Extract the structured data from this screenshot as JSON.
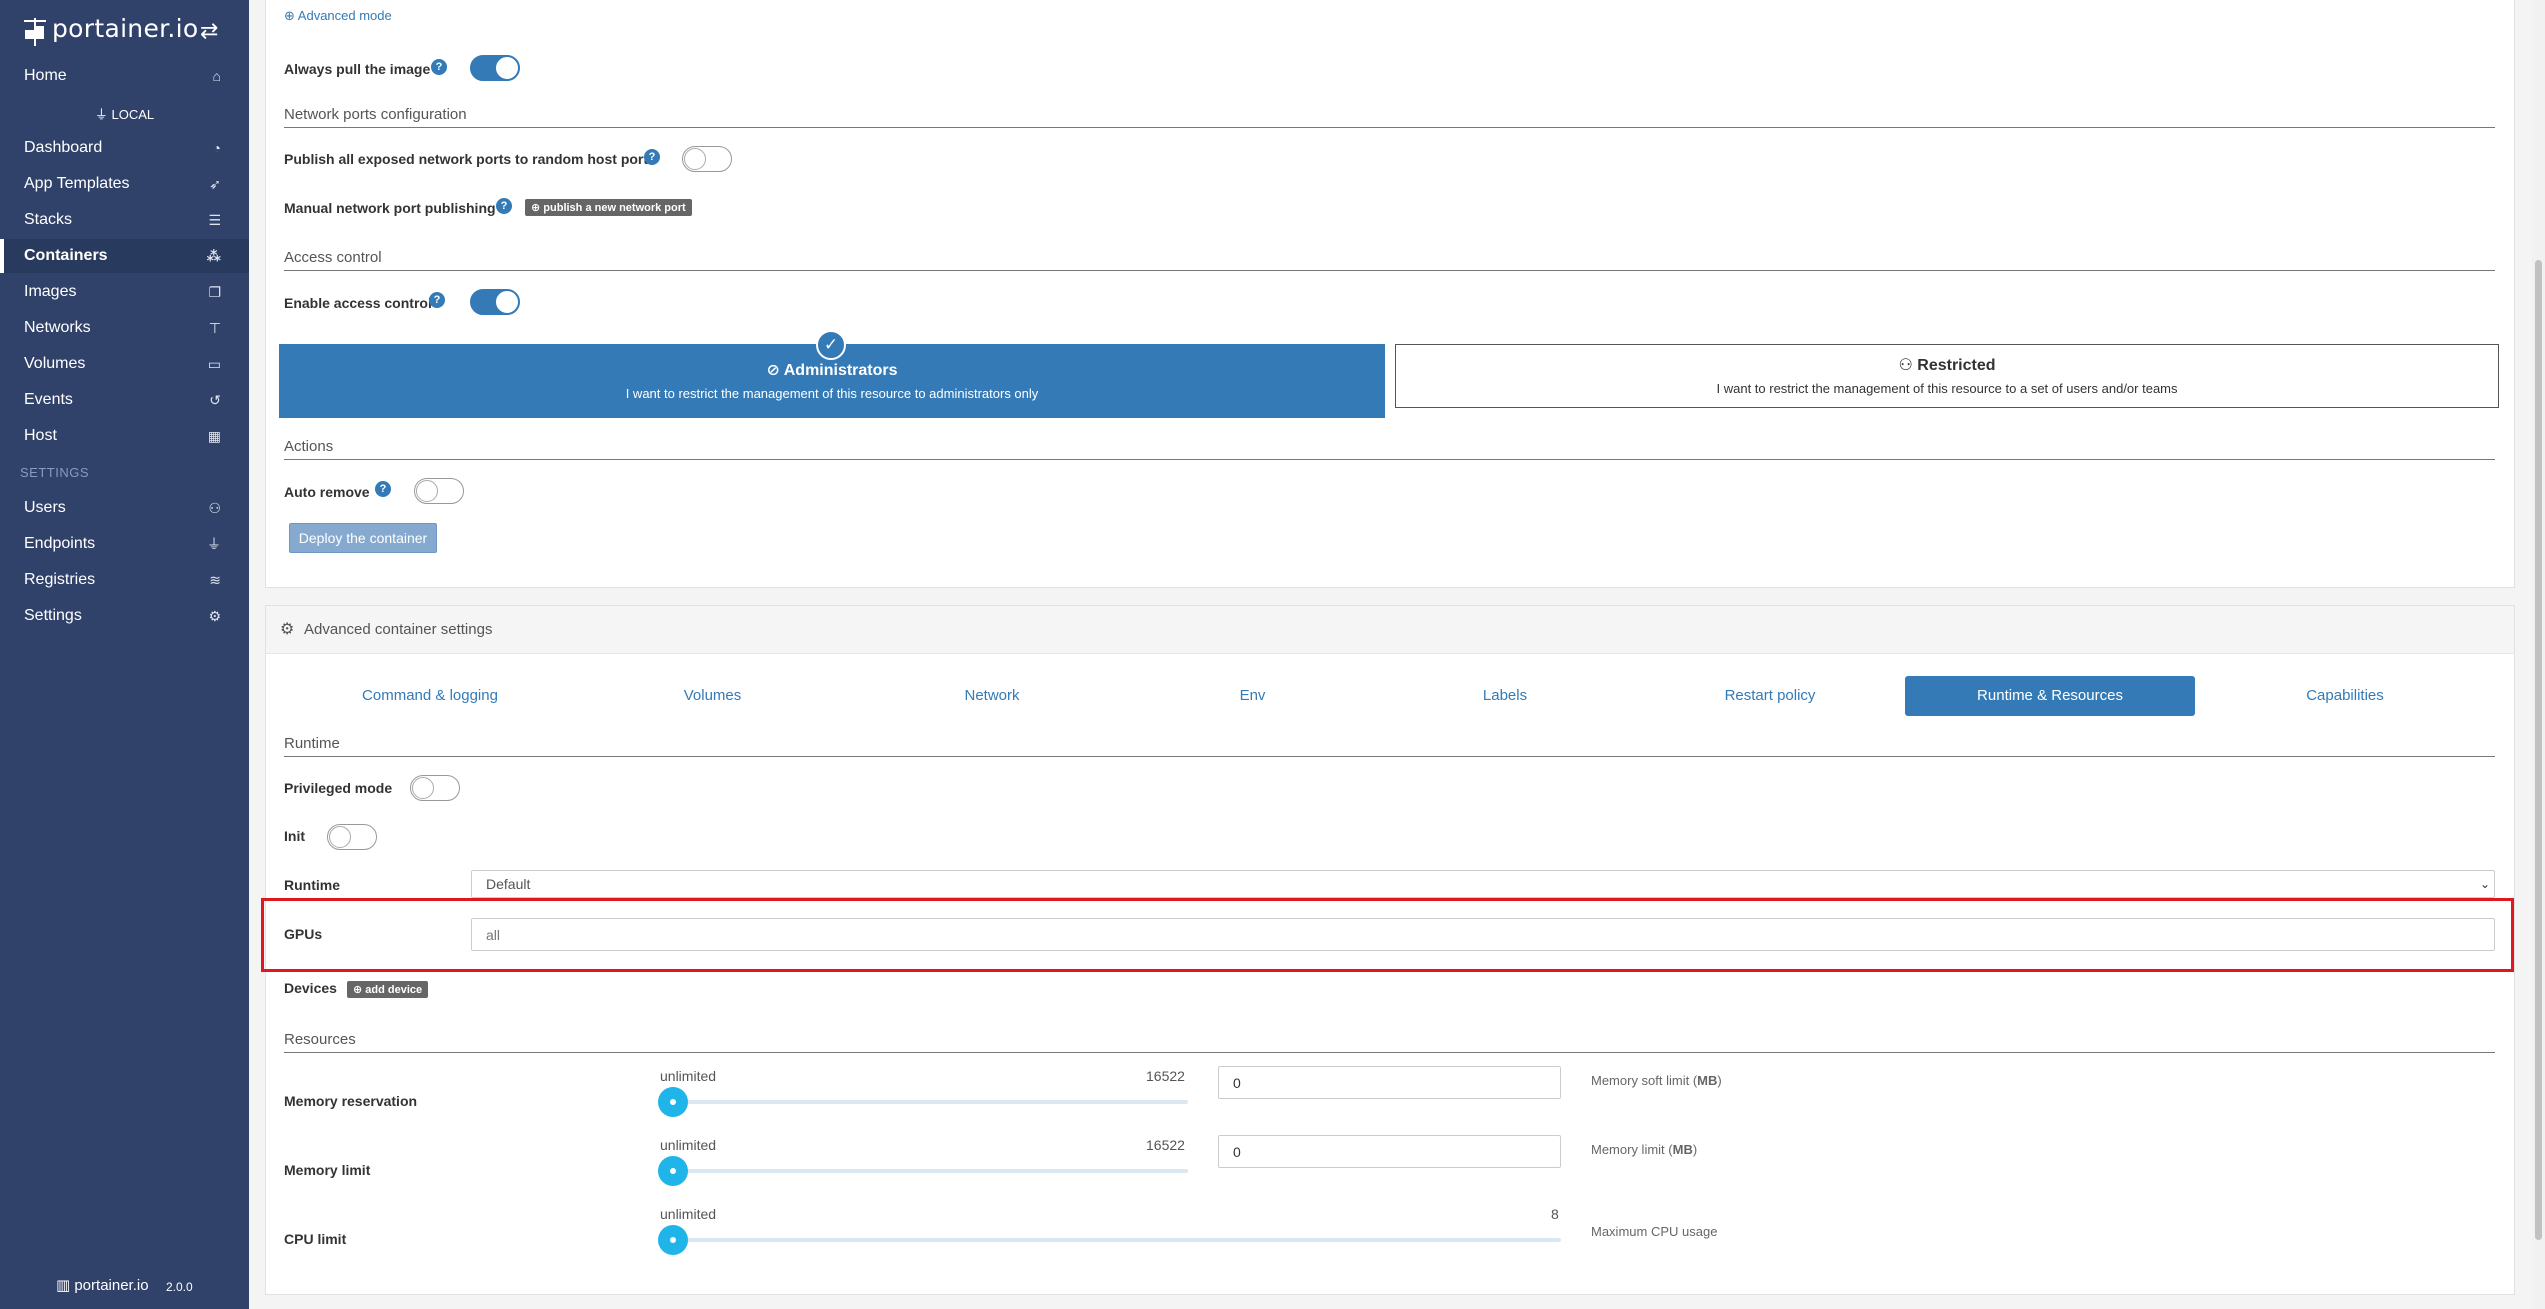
{
  "sidebar": {
    "logo_text": "portainer.io",
    "endpoint_label": "LOCAL",
    "settings_heading": "SETTINGS",
    "items": [
      {
        "label": "Home",
        "icon": "home-icon",
        "glyph": "⌂"
      },
      {
        "label": "Dashboard",
        "icon": "tachometer-icon",
        "glyph": "◔"
      },
      {
        "label": "App Templates",
        "icon": "rocket-icon",
        "glyph": "➶"
      },
      {
        "label": "Stacks",
        "icon": "list-icon",
        "glyph": "☰"
      },
      {
        "label": "Containers",
        "icon": "cubes-icon",
        "glyph": "⁂"
      },
      {
        "label": "Images",
        "icon": "clone-icon",
        "glyph": "❐"
      },
      {
        "label": "Networks",
        "icon": "sitemap-icon",
        "glyph": "⊤"
      },
      {
        "label": "Volumes",
        "icon": "hdd-icon",
        "glyph": "▭"
      },
      {
        "label": "Events",
        "icon": "history-icon",
        "glyph": "↺"
      },
      {
        "label": "Host",
        "icon": "th-icon",
        "glyph": "▦"
      },
      {
        "label": "Users",
        "icon": "users-icon",
        "glyph": "⚇"
      },
      {
        "label": "Endpoints",
        "icon": "plug-icon",
        "glyph": "⏚"
      },
      {
        "label": "Registries",
        "icon": "database-icon",
        "glyph": "≋"
      },
      {
        "label": "Settings",
        "icon": "cogs-icon",
        "glyph": "⚙"
      }
    ],
    "footer_logo": "portainer.io",
    "version": "2.0.0"
  },
  "form": {
    "advanced_mode": "Advanced mode",
    "always_pull": "Always pull the image",
    "network_ports_section": "Network ports configuration",
    "publish_all": "Publish all exposed network ports to random host ports",
    "manual_publishing": "Manual network port publishing",
    "publish_new_port": "publish a new network port",
    "access_control_section": "Access control",
    "enable_access_control": "Enable access control",
    "admin_title": "Administrators",
    "admin_desc": "I want to restrict the management of this resource to administrators only",
    "restricted_title": "Restricted",
    "restricted_desc": "I want to restrict the management of this resource to a set of users and/or teams",
    "actions_section": "Actions",
    "auto_remove": "Auto remove",
    "deploy_button": "Deploy the container"
  },
  "advanced": {
    "header": "Advanced container settings",
    "tabs": [
      "Command & logging",
      "Volumes",
      "Network",
      "Env",
      "Labels",
      "Restart policy",
      "Runtime & Resources",
      "Capabilities"
    ],
    "active_tab": "Runtime & Resources",
    "runtime_section": "Runtime",
    "privileged_mode": "Privileged mode",
    "init": "Init",
    "runtime_label": "Runtime",
    "runtime_value": "Default",
    "gpus_label": "GPUs",
    "gpus_placeholder": "all",
    "devices_label": "Devices",
    "add_device": "add device",
    "resources_section": "Resources",
    "memory_reservation": {
      "label": "Memory reservation",
      "min_label": "unlimited",
      "max_label": "16522",
      "value": "0",
      "hint_prefix": "Memory soft limit (",
      "hint_unit": "MB",
      "hint_suffix": ")"
    },
    "memory_limit": {
      "label": "Memory limit",
      "min_label": "unlimited",
      "max_label": "16522",
      "value": "0",
      "hint_prefix": "Memory limit (",
      "hint_unit": "MB",
      "hint_suffix": ")"
    },
    "cpu_limit": {
      "label": "CPU limit",
      "min_label": "unlimited",
      "max_label": "8",
      "hint": "Maximum CPU usage"
    }
  }
}
